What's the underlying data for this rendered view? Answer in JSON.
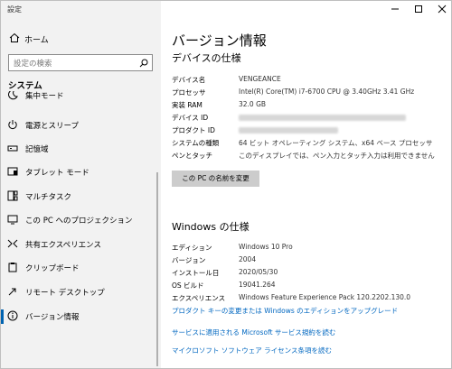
{
  "app": {
    "title": "設定"
  },
  "window_controls": {
    "minimize": "minimize-icon",
    "maximize": "maximize-icon",
    "close": "close-icon"
  },
  "sidebar": {
    "home_label": "ホーム",
    "search_placeholder": "設定の検索",
    "section_label": "システム",
    "items": [
      {
        "label": "集中モード",
        "icon": "moon-icon"
      },
      {
        "label": "電源とスリープ",
        "icon": "power-icon"
      },
      {
        "label": "記憶域",
        "icon": "storage-icon"
      },
      {
        "label": "タブレット モード",
        "icon": "tablet-icon"
      },
      {
        "label": "マルチタスク",
        "icon": "multitask-icon"
      },
      {
        "label": "この PC へのプロジェクション",
        "icon": "projection-icon"
      },
      {
        "label": "共有エクスペリエンス",
        "icon": "share-icon"
      },
      {
        "label": "クリップボード",
        "icon": "clipboard-icon"
      },
      {
        "label": "リモート デスクトップ",
        "icon": "remote-desktop-icon"
      },
      {
        "label": "バージョン情報",
        "icon": "info-icon",
        "selected": true
      }
    ]
  },
  "main": {
    "title": "バージョン情報",
    "device_heading": "デバイスの仕様",
    "device_specs": [
      {
        "key": "デバイス名",
        "value": "VENGEANCE"
      },
      {
        "key": "プロセッサ",
        "value": "Intel(R) Core(TM) i7-6700 CPU @ 3.40GHz   3.41 GHz"
      },
      {
        "key": "実装 RAM",
        "value": "32.0 GB"
      },
      {
        "key": "デバイス ID",
        "value": ""
      },
      {
        "key": "プロダクト ID",
        "value": ""
      },
      {
        "key": "システムの種類",
        "value": "64 ビット オペレーティング システム、x64 ベース プロセッサ"
      },
      {
        "key": "ペンとタッチ",
        "value": "このディスプレイでは、ペン入力とタッチ入力は利用できません"
      }
    ],
    "rename_button": "この PC の名前を変更",
    "windows_heading": "Windows の仕様",
    "windows_specs": [
      {
        "key": "エディション",
        "value": "Windows 10 Pro"
      },
      {
        "key": "バージョン",
        "value": "2004"
      },
      {
        "key": "インストール日",
        "value": "2020/05/30"
      },
      {
        "key": "OS ビルド",
        "value": "19041.264"
      },
      {
        "key": "エクスペリエンス",
        "value": "Windows Feature Experience Pack 120.2202.130.0"
      }
    ],
    "links": {
      "upgrade": "プロダクト キーの変更または Windows のエディションをアップグレード",
      "services": "サービスに適用される Microsoft サービス規約を読む",
      "license": "マイクロソフト ソフトウェア ライセンス条項を読む"
    }
  }
}
